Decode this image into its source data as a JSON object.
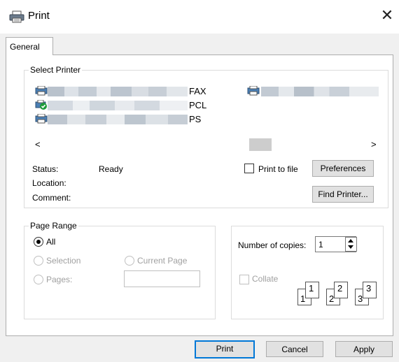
{
  "window": {
    "title": "Print",
    "close_glyph": "✕"
  },
  "tabs": [
    {
      "label": "General"
    }
  ],
  "select_printer": {
    "legend": "Select Printer",
    "printers": [
      {
        "suffix": "FAX"
      },
      {
        "suffix": "PCL"
      },
      {
        "suffix": "PS"
      }
    ],
    "scroll_left": "<",
    "scroll_right": ">"
  },
  "status": {
    "status_label": "Status:",
    "status_value": "Ready",
    "location_label": "Location:",
    "comment_label": "Comment:"
  },
  "print_to_file": {
    "label": "Print to file"
  },
  "buttons": {
    "preferences": "Preferences",
    "find_printer": "Find Printer...",
    "print": "Print",
    "cancel": "Cancel",
    "apply": "Apply"
  },
  "page_range": {
    "legend": "Page Range",
    "all": "All",
    "selection": "Selection",
    "current_page": "Current Page",
    "pages": "Pages:"
  },
  "copies": {
    "label": "Number of copies:",
    "value": "1",
    "collate": "Collate",
    "stack": [
      "1",
      "1",
      "2",
      "2",
      "3",
      "3"
    ]
  },
  "colors": {
    "window_bg": "#f0f0f0",
    "panel_bg": "#ffffff",
    "button_bg": "#e1e1e1",
    "accent_green": "#1e9b3a"
  }
}
